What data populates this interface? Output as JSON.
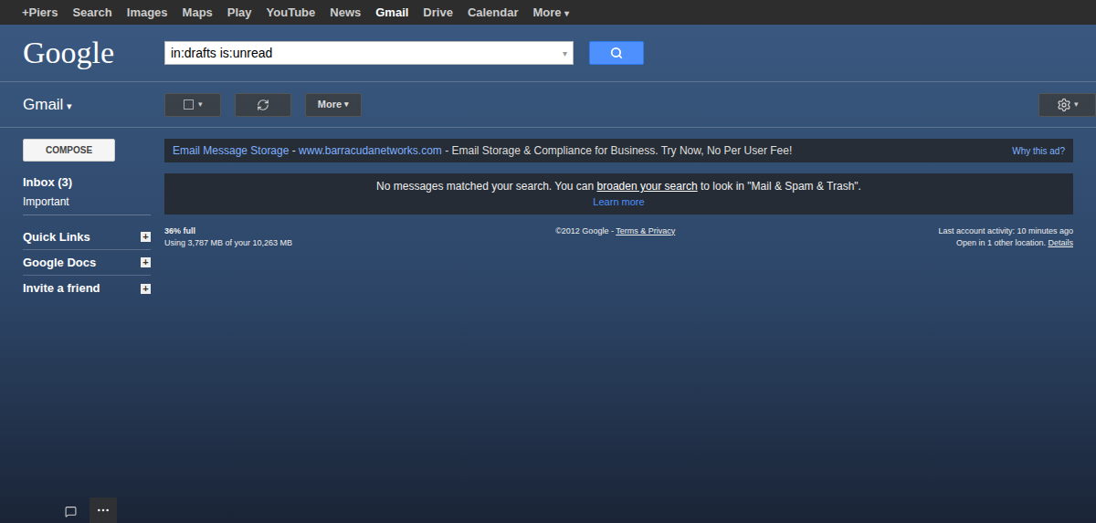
{
  "caret": "▾",
  "topbar": {
    "items": [
      {
        "label": "+Piers",
        "selected": false,
        "dropdown": false
      },
      {
        "label": "Search",
        "selected": false,
        "dropdown": false
      },
      {
        "label": "Images",
        "selected": false,
        "dropdown": false
      },
      {
        "label": "Maps",
        "selected": false,
        "dropdown": false
      },
      {
        "label": "Play",
        "selected": false,
        "dropdown": false
      },
      {
        "label": "YouTube",
        "selected": false,
        "dropdown": false
      },
      {
        "label": "News",
        "selected": false,
        "dropdown": false
      },
      {
        "label": "Gmail",
        "selected": true,
        "dropdown": false
      },
      {
        "label": "Drive",
        "selected": false,
        "dropdown": false
      },
      {
        "label": "Calendar",
        "selected": false,
        "dropdown": false
      },
      {
        "label": "More",
        "selected": false,
        "dropdown": true
      }
    ]
  },
  "header": {
    "logo": "Google",
    "search": {
      "value": "in:drafts is:unread"
    }
  },
  "toolbar": {
    "app": "Gmail",
    "more": "More"
  },
  "sidebar": {
    "compose": "COMPOSE",
    "items": [
      {
        "label": "Inbox (3)",
        "bold": true
      },
      {
        "label": "Important",
        "bold": false
      }
    ],
    "expand_glyph": "+",
    "sections": [
      {
        "label": "Quick Links"
      },
      {
        "label": "Google Docs"
      },
      {
        "label": "Invite a friend"
      }
    ]
  },
  "ad": {
    "title": "Email Message Storage",
    "separator": " - ",
    "url": "www.barracudanetworks.com",
    "text": " - Email Storage & Compliance for Business. Try Now, No Per User Fee!",
    "why": "Why this ad?"
  },
  "notice": {
    "before": "No messages matched your search. You can ",
    "link": "broaden your search",
    "after": " to look in \"Mail & Spam & Trash\".",
    "learn_more": "Learn more"
  },
  "footer": {
    "storage_percent": "36% full",
    "storage_usage": "Using 3,787 MB of your 10,263 MB",
    "copyright": "©2012 Google - ",
    "terms": "Terms & Privacy",
    "last_activity": "Last account activity: 10 minutes ago",
    "other_location": "Open in 1 other location. ",
    "details": "Details"
  }
}
